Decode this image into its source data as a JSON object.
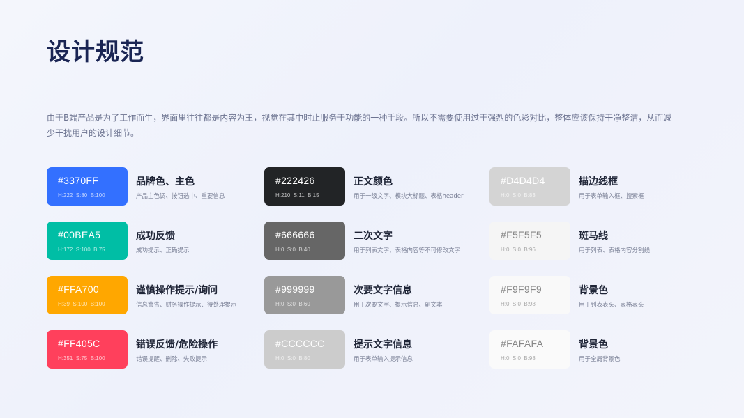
{
  "title": "设计规范",
  "description": "由于B端产品是为了工作而生，界面里往往都是内容为王，视觉在其中时止服务于功能的一种手段。所以不需要使用过于强烈的色彩对比，整体应该保持干净整洁，从而减少干扰用户的设计细节。",
  "columns": [
    {
      "swatches": [
        {
          "hex": "#3370FF",
          "hsb": "H:222  S:80  B:100",
          "name": "品牌色、主色",
          "desc": "产品主色调、按钮选中、重要信息",
          "color": "#3370FF",
          "text_color": "#FFFFFF"
        },
        {
          "hex": "#00BEA5",
          "hsb": "H:172  S:100  B:75",
          "name": "成功反馈",
          "desc": "成功提示、正确提示",
          "color": "#00BEA5",
          "text_color": "#FFFFFF"
        },
        {
          "hex": "#FFA700",
          "hsb": "H:39  S:100  B:100",
          "name": "谨慎操作提示/询问",
          "desc": "信息警告、财务操作提示、待处理提示",
          "color": "#FFA700",
          "text_color": "#FFFFFF"
        },
        {
          "hex": "#FF405C",
          "hsb": "H:351  S:75  B:100",
          "name": "错误反馈/危险操作",
          "desc": "错误提醒、删除、失败提示",
          "color": "#FF405C",
          "text_color": "#FFFFFF"
        }
      ]
    },
    {
      "swatches": [
        {
          "hex": "#222426",
          "hsb": "H:210  S:11  B:15",
          "name": "正文颜色",
          "desc": "用于一级文字、模块大标题、表格header",
          "color": "#222426",
          "text_color": "#FFFFFF"
        },
        {
          "hex": "#666666",
          "hsb": "H:0  S:0  B:40",
          "name": "二次文字",
          "desc": "用于列表文字、表格内容等不可修改文字",
          "color": "#666666",
          "text_color": "#FFFFFF"
        },
        {
          "hex": "#999999",
          "hsb": "H:0  S:0  B:60",
          "name": "次要文字信息",
          "desc": "用于次要文字、提示信息、副文本",
          "color": "#999999",
          "text_color": "#FFFFFF"
        },
        {
          "hex": "#CCCCCC",
          "hsb": "H:0  S:0  B:80",
          "name": "提示文字信息",
          "desc": "用于表单输入提示信息",
          "color": "#CCCCCC",
          "text_color": "#FFFFFF"
        }
      ]
    },
    {
      "swatches": [
        {
          "hex": "#D4D4D4",
          "hsb": "H:0  S:0  B:83",
          "name": "描边线框",
          "desc": "用于表单输入框、搜索框",
          "color": "#D4D4D4",
          "text_color": "#FFFFFF"
        },
        {
          "hex": "#F5F5F5",
          "hsb": "H:0  S:0  B:96",
          "name": "斑马线",
          "desc": "用于列表、表格内容分割线",
          "color": "#F5F5F5",
          "text_color": "#888888"
        },
        {
          "hex": "#F9F9F9",
          "hsb": "H:0  S:0  B:98",
          "name": "背景色",
          "desc": "用于列表表头、表格表头",
          "color": "#F9F9F9",
          "text_color": "#888888"
        },
        {
          "hex": "#FAFAFA",
          "hsb": "H:0  S:0  B:98",
          "name": "背景色",
          "desc": "用于全局背景色",
          "color": "#FAFAFA",
          "text_color": "#888888"
        }
      ]
    }
  ]
}
